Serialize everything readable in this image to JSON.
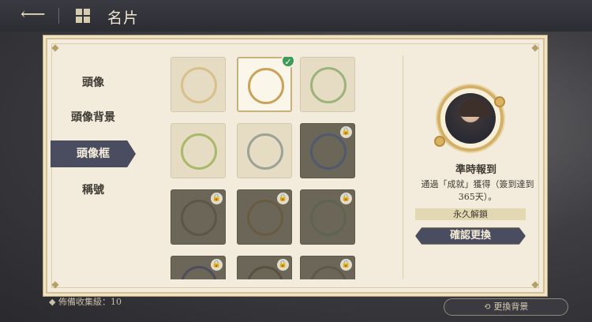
{
  "topbar": {
    "title": "名片",
    "back_icon": "back-arrow-icon",
    "home_icon": "grid-home-icon"
  },
  "background": {
    "footer_text": "◆ 佈備收集級：10",
    "change_bg_button": "更換背景"
  },
  "categories": [
    {
      "label": "頭像",
      "active": false
    },
    {
      "label": "頭像背景",
      "active": false
    },
    {
      "label": "頭像框",
      "active": true
    },
    {
      "label": "稱號",
      "active": false
    }
  ],
  "frames": [
    {
      "name": "plain-gold-ring",
      "locked": false,
      "selected": false,
      "color": "#d8c08a"
    },
    {
      "name": "clock-gold-ring",
      "locked": false,
      "selected": true,
      "color": "#caa35a"
    },
    {
      "name": "leaf-vine-ring",
      "locked": false,
      "selected": false,
      "color": "#9cb37c"
    },
    {
      "name": "flower-candle-ring",
      "locked": false,
      "selected": false,
      "color": "#a9b96a"
    },
    {
      "name": "teapot-ribbon-ring",
      "locked": false,
      "selected": false,
      "color": "#9aa29a"
    },
    {
      "name": "blue-ring",
      "locked": true,
      "selected": false,
      "color": "#4f5a70"
    },
    {
      "name": "dark-ring-1",
      "locked": true,
      "selected": false,
      "color": "#5c5648"
    },
    {
      "name": "dark-ring-2",
      "locked": true,
      "selected": false,
      "color": "#6a5a40"
    },
    {
      "name": "dark-ring-3",
      "locked": true,
      "selected": false,
      "color": "#5e6450"
    },
    {
      "name": "dark-ring-4",
      "locked": true,
      "selected": false,
      "color": "#504c60"
    },
    {
      "name": "dark-ring-5",
      "locked": true,
      "selected": false,
      "color": "#5a5040"
    },
    {
      "name": "dark-ring-6",
      "locked": true,
      "selected": false,
      "color": "#5d5848"
    }
  ],
  "preview": {
    "frame_name": "準時報到",
    "description": "通過「成就」獲得（簽到達到365天）。",
    "permanence": "永久解鎖",
    "confirm_button": "確認更換"
  }
}
